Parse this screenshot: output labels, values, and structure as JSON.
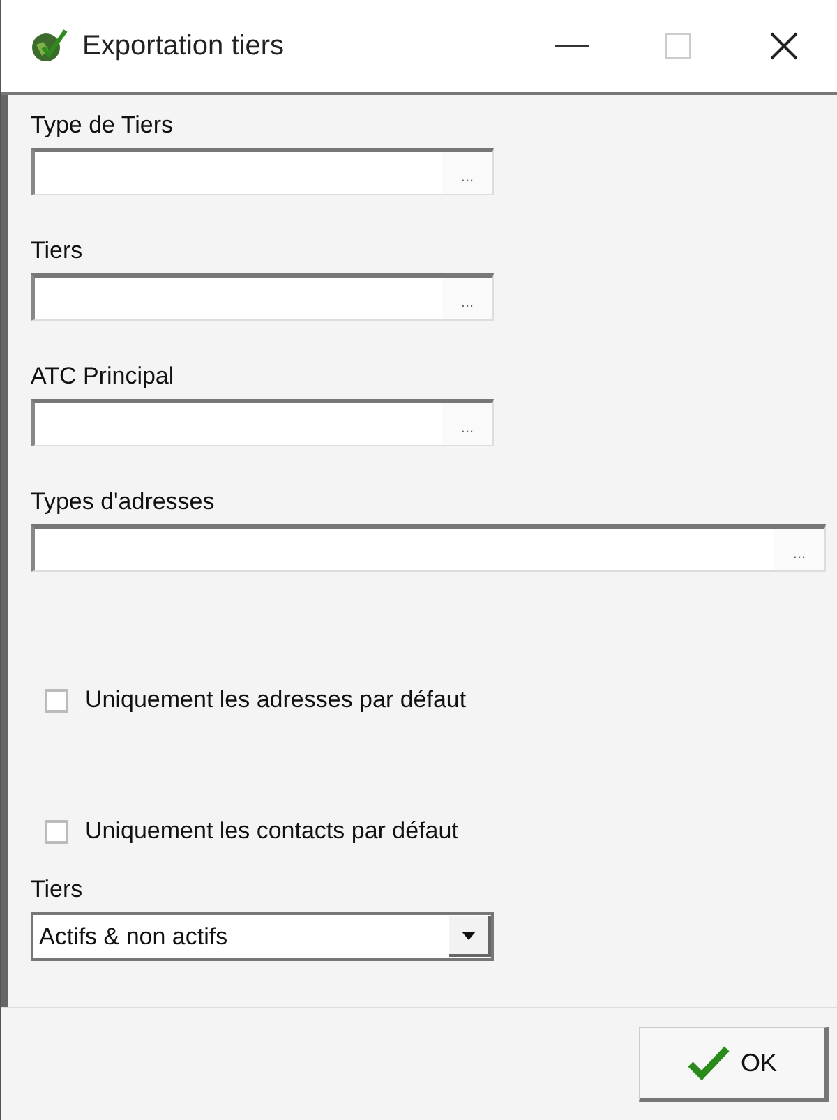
{
  "window": {
    "title": "Exportation tiers"
  },
  "fields": [
    {
      "kind": "picker",
      "label": "Type de Tiers",
      "button": "...",
      "wide": false
    },
    {
      "kind": "picker",
      "label": "Tiers",
      "button": "...",
      "wide": false
    },
    {
      "kind": "picker",
      "label": "ATC Principal",
      "button": "...",
      "wide": false
    },
    {
      "kind": "picker",
      "label": "Types d'adresses",
      "button": "...",
      "wide": true
    }
  ],
  "checkboxes": [
    {
      "label": "Uniquement les adresses par défaut",
      "checked": false
    },
    {
      "label": "Uniquement les contacts par défaut",
      "checked": false
    }
  ],
  "select": {
    "label": "Tiers",
    "value": "Actifs & non actifs"
  },
  "buttons": [
    {
      "label": "OK"
    }
  ]
}
